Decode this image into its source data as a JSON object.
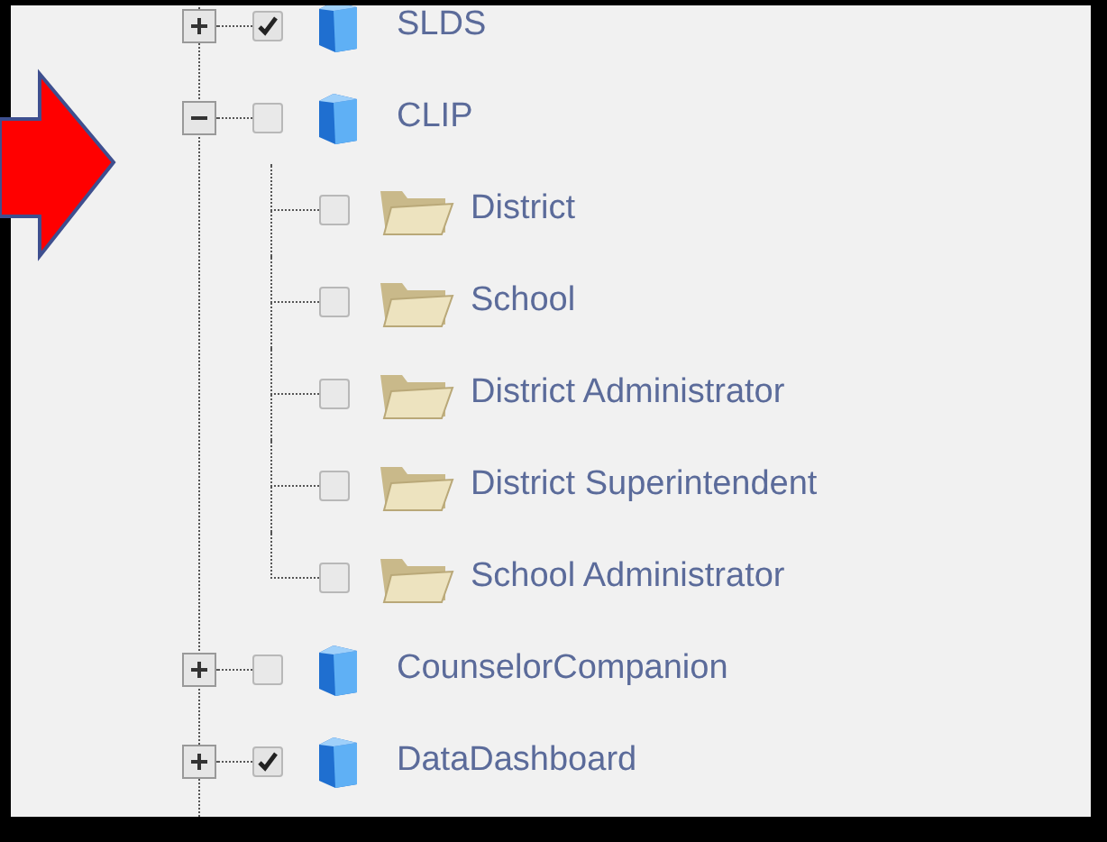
{
  "tree": [
    {
      "label": "SLDS",
      "kind": "database",
      "checked": true,
      "expanded": false
    },
    {
      "label": "CLIP",
      "kind": "database",
      "checked": false,
      "expanded": true,
      "children": [
        {
          "label": "District",
          "kind": "folder",
          "checked": false
        },
        {
          "label": "School",
          "kind": "folder",
          "checked": false
        },
        {
          "label": "District Administrator",
          "kind": "folder",
          "checked": false
        },
        {
          "label": "District Superintendent",
          "kind": "folder",
          "checked": false
        },
        {
          "label": "School Administrator",
          "kind": "folder",
          "checked": false
        }
      ]
    },
    {
      "label": "CounselorCompanion",
      "kind": "database",
      "checked": false,
      "expanded": false
    },
    {
      "label": "DataDashboard",
      "kind": "database",
      "checked": true,
      "expanded": false
    }
  ]
}
